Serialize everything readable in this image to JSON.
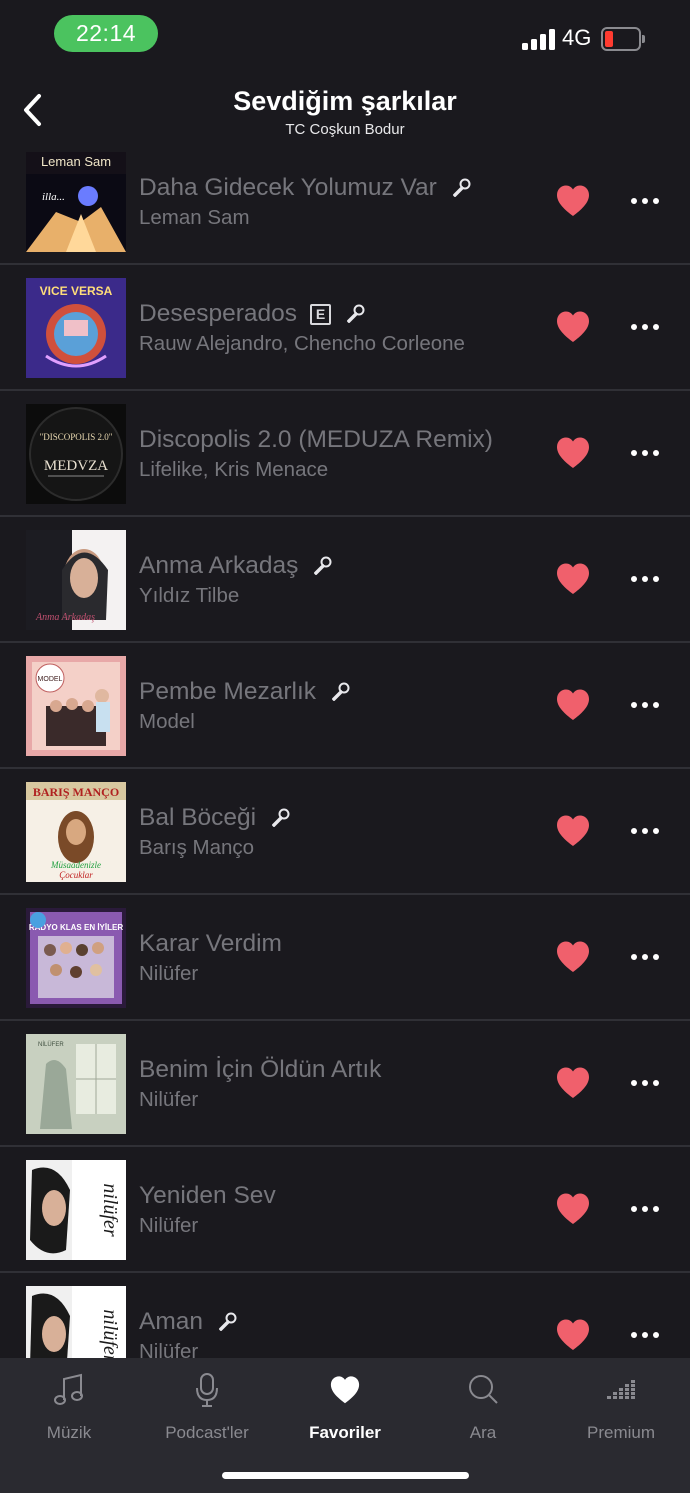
{
  "status": {
    "time": "22:14",
    "network": "4G",
    "battery_color": "#ff3b30"
  },
  "header": {
    "title": "Sevdiğim şarkılar",
    "subtitle": "TC Coşkun Bodur",
    "back_icon": "chevron-left-icon"
  },
  "songs": [
    {
      "title": "Daha Gidecek Yolumuz Var",
      "artist": "Leman Sam",
      "explicit": false,
      "lyrics": true,
      "liked": true,
      "cover_text": "Leman Sam"
    },
    {
      "title": "Desesperados",
      "artist": "Rauw Alejandro, Chencho Corleone",
      "explicit": true,
      "explicit_label": "E",
      "lyrics": true,
      "liked": true,
      "cover_text": "VICE VERSA"
    },
    {
      "title": "Discopolis 2.0 (MEDUZA Remix)",
      "artist": "Lifelike, Kris Menace",
      "explicit": false,
      "lyrics": false,
      "liked": true,
      "cover_text": "MEDVZA"
    },
    {
      "title": "Anma Arkadaş",
      "artist": "Yıldız Tilbe",
      "explicit": false,
      "lyrics": true,
      "liked": true,
      "cover_text": ""
    },
    {
      "title": "Pembe Mezarlık",
      "artist": "Model",
      "explicit": false,
      "lyrics": true,
      "liked": true,
      "cover_text": "MODEL"
    },
    {
      "title": "Bal Böceği",
      "artist": "Barış Manço",
      "explicit": false,
      "lyrics": true,
      "liked": true,
      "cover_text": "BARIŞ MANÇO"
    },
    {
      "title": "Karar Verdim",
      "artist": "Nilüfer",
      "explicit": false,
      "lyrics": false,
      "liked": true,
      "cover_text": "RADYO KLAS EN İYİLER"
    },
    {
      "title": "Benim İçin Öldün Artık",
      "artist": "Nilüfer",
      "explicit": false,
      "lyrics": false,
      "liked": true,
      "cover_text": "NİLÜFER"
    },
    {
      "title": "Yeniden Sev",
      "artist": "Nilüfer",
      "explicit": false,
      "lyrics": false,
      "liked": true,
      "cover_text": "nilüfer"
    },
    {
      "title": "Aman",
      "artist": "Nilüfer",
      "explicit": false,
      "lyrics": true,
      "liked": true,
      "cover_text": "nilüfer"
    }
  ],
  "tabs": [
    {
      "label": "Müzik",
      "icon": "music-note-icon",
      "active": false
    },
    {
      "label": "Podcast'ler",
      "icon": "microphone-icon",
      "active": false
    },
    {
      "label": "Favoriler",
      "icon": "heart-icon",
      "active": true
    },
    {
      "label": "Ara",
      "icon": "search-icon",
      "active": false
    },
    {
      "label": "Premium",
      "icon": "equalizer-icon",
      "active": false
    }
  ],
  "colors": {
    "background": "#1a191e",
    "heart": "#f0606c",
    "muted_text": "#76767c",
    "tabbar": "#2a2a30",
    "time_pill": "#4bc35f"
  }
}
